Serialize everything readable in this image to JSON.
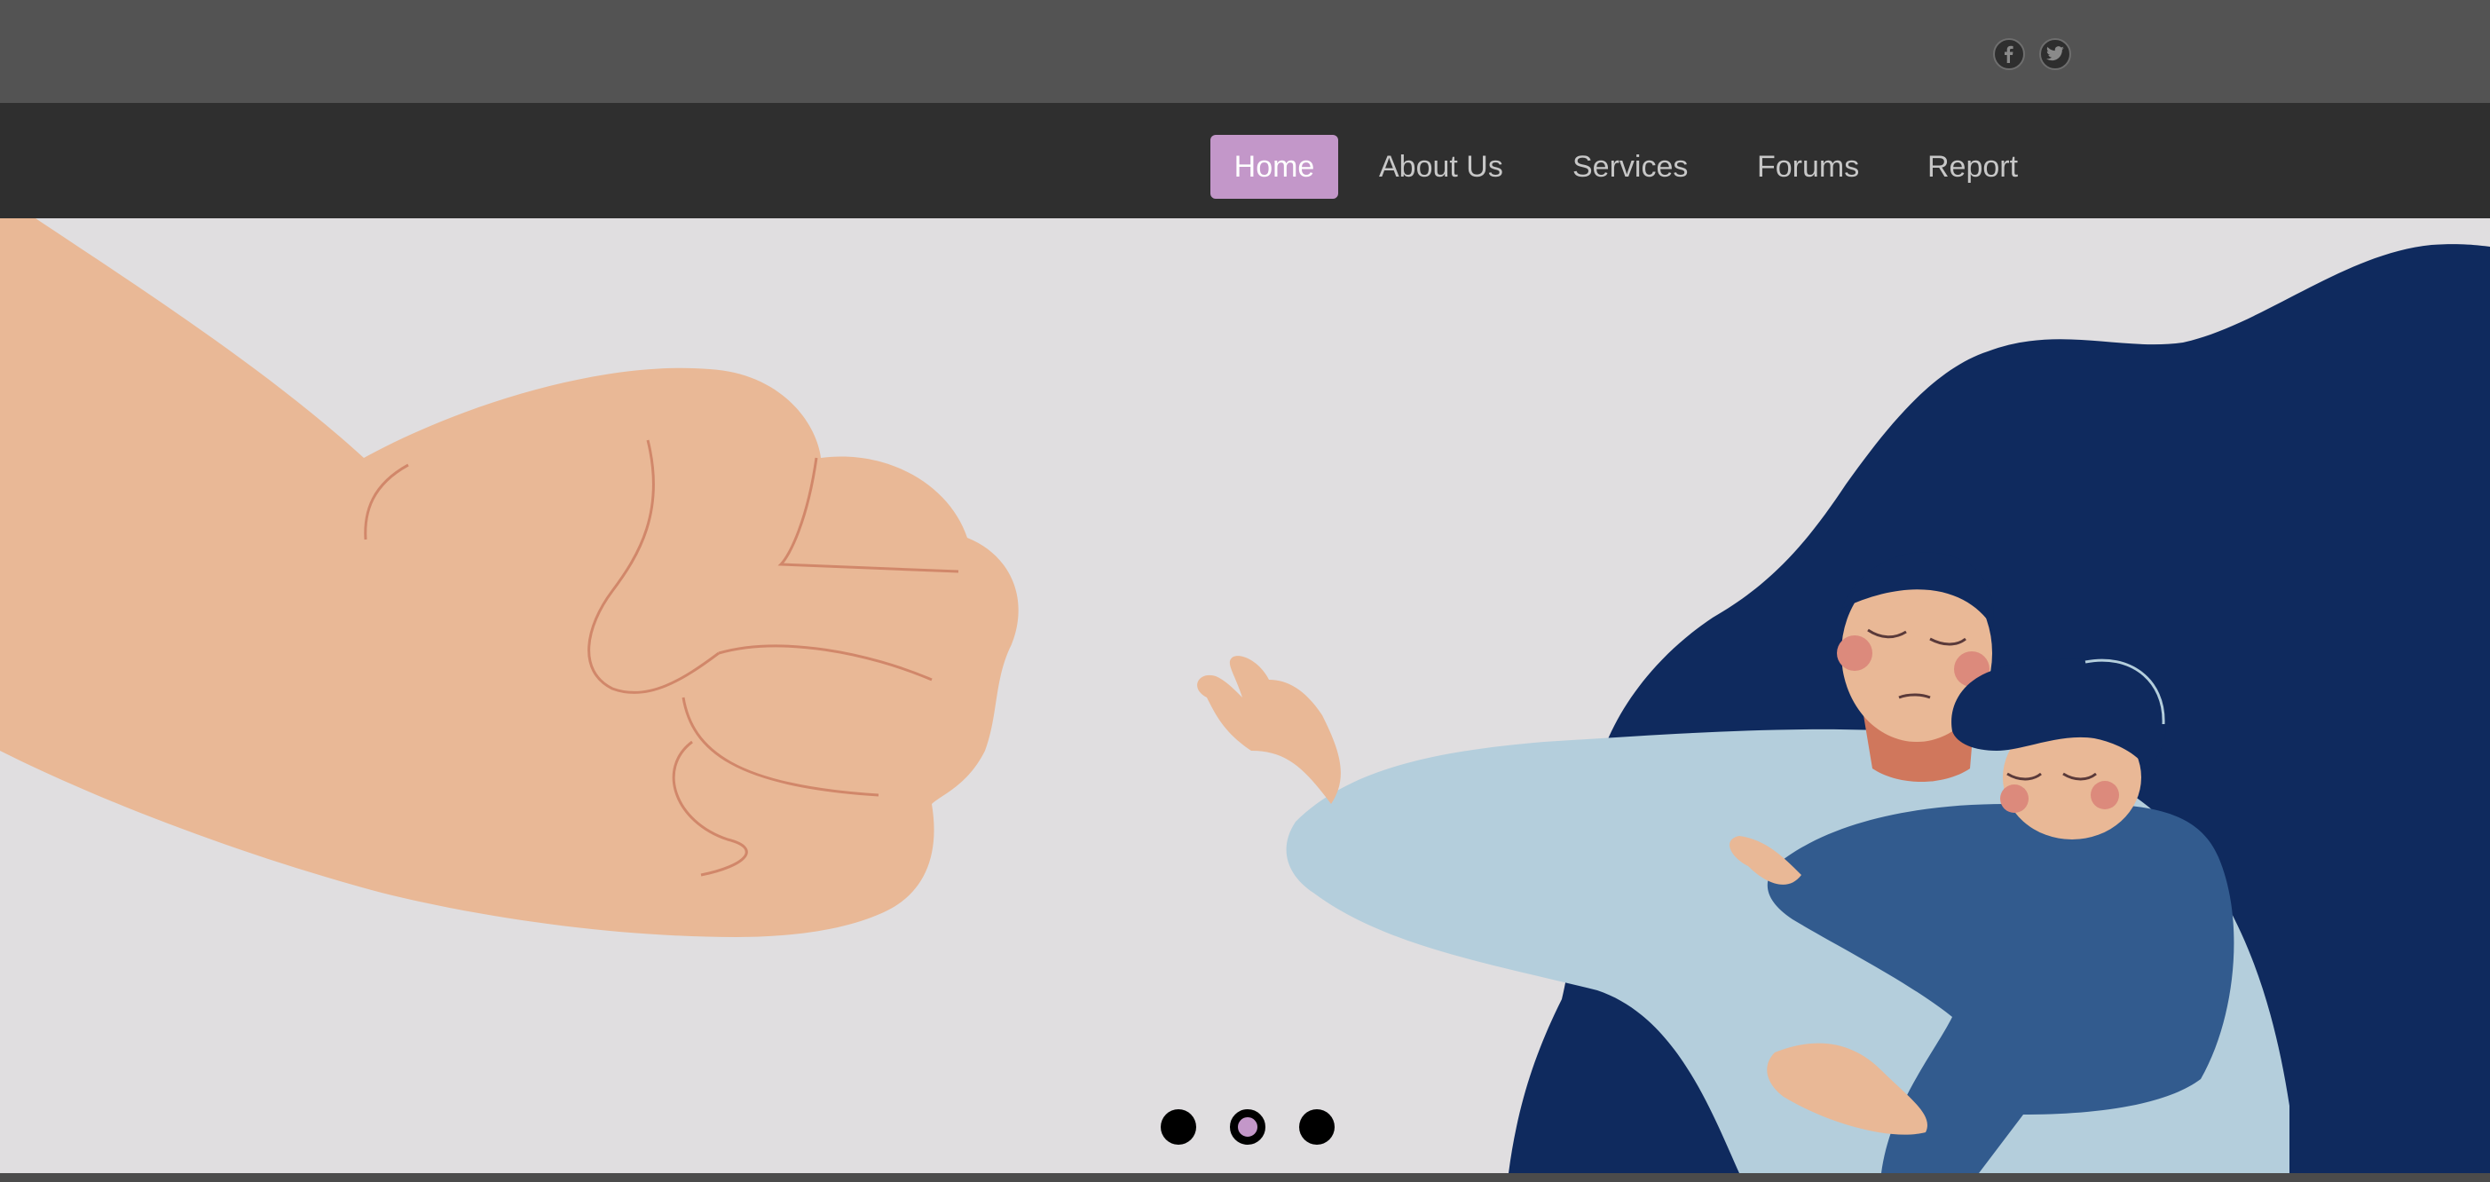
{
  "social": {
    "facebook_icon": "facebook-icon",
    "twitter_icon": "twitter-icon"
  },
  "nav": {
    "items": [
      {
        "label": "Home",
        "active": true
      },
      {
        "label": "About Us",
        "active": false
      },
      {
        "label": "Services",
        "active": false
      },
      {
        "label": "Forums",
        "active": false
      },
      {
        "label": "Report",
        "active": false
      }
    ]
  },
  "carousel": {
    "slide_count": 3,
    "active_index": 1
  },
  "colors": {
    "accent": "#c397c9",
    "topbar": "#535353",
    "navbar": "#2f2f2f",
    "hero_background": "#e0dee0",
    "hair": "#0f2a5e",
    "skin": "#e9b896",
    "shirt_light": "#b4cedc",
    "shirt_dark": "#325b8e"
  }
}
